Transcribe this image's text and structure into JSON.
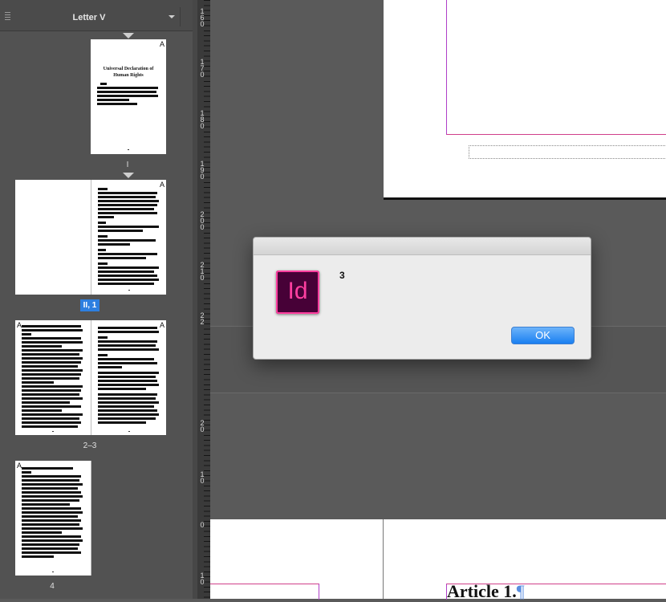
{
  "pages_panel": {
    "master_name": "Letter V",
    "page_labels": [
      "I",
      "II, 1",
      "2–3",
      "4"
    ],
    "master_prefix": "A",
    "cover_title": "Universal Declaration of Human Rights"
  },
  "ruler": {
    "numbers": [
      "1 6 0",
      "1 7 0",
      "1 8 0",
      "1 9 0",
      "2 0 0",
      "2 1 0",
      "2 2",
      "2 0",
      "1 0",
      "0",
      "1 0"
    ]
  },
  "document": {
    "heading_text": "Article 1.",
    "pilcrow": "¶"
  },
  "dialog": {
    "message": "3",
    "ok_label": "OK",
    "app_icon_label": "Id"
  },
  "colors": {
    "panel_bg": "#525252",
    "selection_blue": "#2d7fe0",
    "margin_magenta": "#d0408a",
    "indesign_pink": "#ff3fa0",
    "indesign_dark": "#470137"
  }
}
